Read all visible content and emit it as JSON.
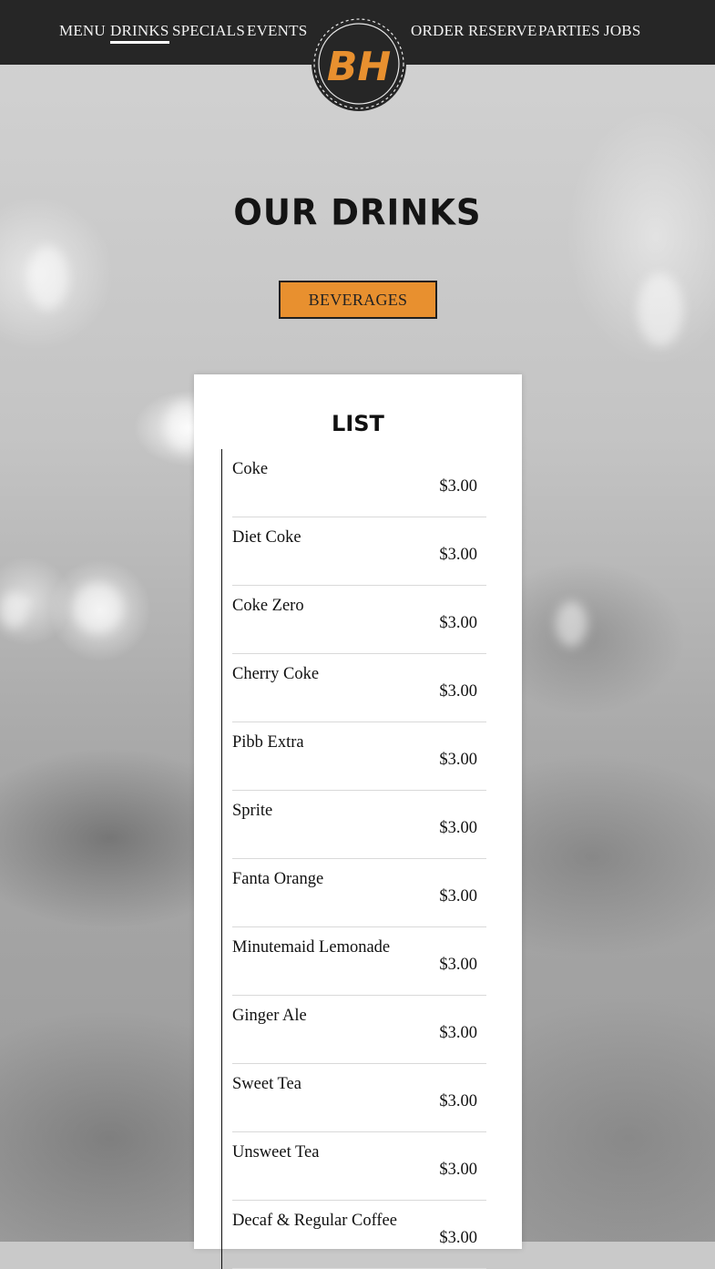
{
  "nav": {
    "left": [
      "MENU",
      "DRINKS",
      "SPECIALS",
      "EVENTS"
    ],
    "right": [
      "ORDER",
      "RESERVE",
      "PARTIES",
      "JOBS"
    ],
    "active": "DRINKS"
  },
  "logo": {
    "text": "BH",
    "color": "#e8902f"
  },
  "page": {
    "heading": "OUR DRINKS",
    "category_button": "BEVERAGES"
  },
  "list": {
    "title": "LIST",
    "items": [
      {
        "name": "Coke",
        "price": "$3.00"
      },
      {
        "name": "Diet Coke",
        "price": "$3.00"
      },
      {
        "name": "Coke Zero",
        "price": "$3.00"
      },
      {
        "name": "Cherry Coke",
        "price": "$3.00"
      },
      {
        "name": "Pibb Extra",
        "price": "$3.00"
      },
      {
        "name": "Sprite",
        "price": "$3.00"
      },
      {
        "name": "Fanta Orange",
        "price": "$3.00"
      },
      {
        "name": "Minutemaid Lemonade",
        "price": "$3.00"
      },
      {
        "name": "Ginger Ale",
        "price": "$3.00"
      },
      {
        "name": "Sweet Tea",
        "price": "$3.00"
      },
      {
        "name": "Unsweet Tea",
        "price": "$3.00"
      },
      {
        "name": "Decaf & Regular Coffee",
        "price": "$3.00"
      }
    ]
  },
  "colors": {
    "nav_bg": "#262626",
    "accent": "#e8902f"
  }
}
